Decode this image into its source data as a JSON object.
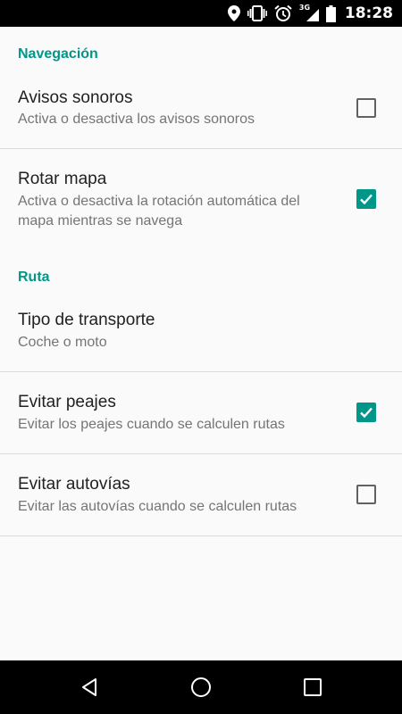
{
  "status_bar": {
    "network_label": "3G",
    "time": "18:28",
    "icons": [
      "location-icon",
      "vibrate-icon",
      "alarm-icon",
      "signal-icon",
      "battery-icon"
    ]
  },
  "colors": {
    "accent": "#009688",
    "status_bar_bg": "#000000",
    "nav_bar_bg": "#000000",
    "background": "#fafafa"
  },
  "sections": {
    "navegacion": {
      "header": "Navegación",
      "avisos_sonoros": {
        "title": "Avisos sonoros",
        "summary": "Activa o desactiva los avisos sonoros",
        "checked": false
      },
      "rotar_mapa": {
        "title": "Rotar mapa",
        "summary": "Activa o desactiva la rotación automática del mapa mientras se navega",
        "checked": true
      }
    },
    "ruta": {
      "header": "Ruta",
      "tipo_transporte": {
        "title": "Tipo de transporte",
        "summary": "Coche o moto"
      },
      "evitar_peajes": {
        "title": "Evitar peajes",
        "summary": "Evitar los peajes cuando se calculen rutas",
        "checked": true
      },
      "evitar_autovias": {
        "title": "Evitar autovías",
        "summary": "Evitar las autovías cuando se calculen rutas",
        "checked": false
      }
    }
  },
  "nav_bar": {
    "icons": [
      "back-icon",
      "home-icon",
      "recents-icon"
    ]
  }
}
